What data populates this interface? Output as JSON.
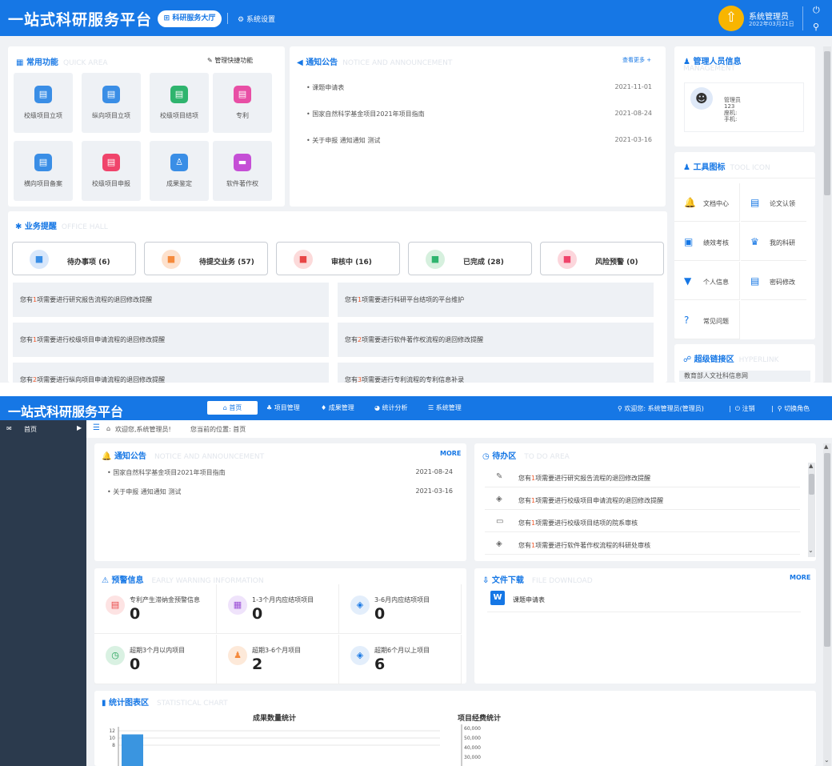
{
  "top": {
    "brand": "一站式科研服务平台",
    "nav_active": "科研服务大厅",
    "nav_settings": "系统设置",
    "user_name": "系统管理员",
    "user_date": "2022年03月21日",
    "quick": {
      "title": "常用功能",
      "title_en": "QUICK AREA",
      "manage": "管理快捷功能",
      "items": [
        {
          "label": "校级项目立项",
          "color": "#3a8ee6",
          "glyph": "▤"
        },
        {
          "label": "纵向项目立项",
          "color": "#3a8ee6",
          "glyph": "▤"
        },
        {
          "label": "校级项目结项",
          "color": "#2fb46e",
          "glyph": "▤"
        },
        {
          "label": "专利",
          "color": "#e84fa5",
          "glyph": "▤"
        },
        {
          "label": "横向项目备案",
          "color": "#3a8ee6",
          "glyph": "▤"
        },
        {
          "label": "校级项目申报",
          "color": "#f0446b",
          "glyph": "▤"
        },
        {
          "label": "成果鉴定",
          "color": "#3a8ee6",
          "glyph": "♙"
        },
        {
          "label": "软件著作权",
          "color": "#c54fd6",
          "glyph": "▬"
        }
      ]
    },
    "notice": {
      "title": "通知公告",
      "title_en": "NOTICE AND ANNOUNCEMENT",
      "more": "查看更多 +",
      "items": [
        {
          "text": "课题申请表",
          "date": "2021-11-01"
        },
        {
          "text": "国家自然科学基金项目2021年项目指南",
          "date": "2021-08-24"
        },
        {
          "text": "关于申报 通知通知 测试",
          "date": "2021-03-16"
        }
      ]
    },
    "manager": {
      "title": "管理人员信息",
      "title_en": "MANAGEMENT",
      "name": "管理员",
      "id": "123",
      "phone_label": "座机:",
      "mobile_label": "手机:"
    },
    "tools": {
      "title": "工具图标",
      "title_en": "TOOL ICON",
      "items": [
        {
          "label": "文档中心",
          "glyph": "🔔"
        },
        {
          "label": "论文认领",
          "glyph": "▤"
        },
        {
          "label": "绩效考核",
          "glyph": "▣"
        },
        {
          "label": "我的科研",
          "glyph": "♛"
        },
        {
          "label": "个人信息",
          "glyph": "▼"
        },
        {
          "label": "密码修改",
          "glyph": "▤"
        },
        {
          "label": "常见问题",
          "glyph": "?"
        }
      ]
    },
    "hyperlink": {
      "title": "超级链接区",
      "title_en": "HYPERLINK",
      "first": "教育部人文社科信息网"
    },
    "business": {
      "title": "业务提醒",
      "title_en": "OFFICE HALL",
      "buttons": [
        {
          "label": "待办事项 (6)",
          "color": "#d8e7fb",
          "fg": "#3a8ee6"
        },
        {
          "label": "待提交业务 (57)",
          "color": "#fde1cd",
          "fg": "#f58a3c"
        },
        {
          "label": "审核中 (16)",
          "color": "#fcdada",
          "fg": "#e84545"
        },
        {
          "label": "已完成 (28)",
          "color": "#d6f0de",
          "fg": "#2fb46e"
        },
        {
          "label": "风险预警 (0)",
          "color": "#fcd6dc",
          "fg": "#f0446b"
        }
      ],
      "reminders": [
        {
          "pre": "您有",
          "n": "1",
          "post": "项需要进行研究报告流程的退回修改提醒"
        },
        {
          "pre": "您有",
          "n": "1",
          "post": "项需要进行科研平台结项的平台维护"
        },
        {
          "pre": "您有",
          "n": "1",
          "post": "项需要进行校级项目申请流程的退回修改提醒"
        },
        {
          "pre": "您有",
          "n": "2",
          "post": "项需要进行软件著作权流程的退回修改提醒"
        },
        {
          "pre": "您有",
          "n": "2",
          "post": "项需要进行纵向项目申请流程的退回修改提醒"
        },
        {
          "pre": "您有",
          "n": "3",
          "post": "项需要进行专利流程的专利信息补录"
        }
      ]
    }
  },
  "bottom": {
    "brand": "一站式科研服务平台",
    "nav": [
      "首页",
      "项目管理",
      "成果管理",
      "统计分析",
      "系统管理"
    ],
    "welcome": "欢迎您: 系统管理员(管理员)",
    "logout": "注销",
    "switch_role": "切换角色",
    "sidebar_home": "首页",
    "breadcrumb_welcome": "欢迎您,系统管理员!",
    "breadcrumb_loc": "您当前的位置: 首页",
    "notice": {
      "title": "通知公告",
      "title_en": "NOTICE AND ANNOUNCEMENT",
      "more": "MORE",
      "items": [
        {
          "text": "国家自然科学基金项目2021年项目指南",
          "date": "2021-08-24"
        },
        {
          "text": "关于申报 通知通知 测试",
          "date": "2021-03-16"
        }
      ]
    },
    "todo": {
      "title": "待办区",
      "title_en": "TO DO AREA",
      "items": [
        {
          "glyph": "✎",
          "pre": "您有",
          "n": "1",
          "post": "项需要进行研究报告流程的退回修改提醒"
        },
        {
          "glyph": "◈",
          "pre": "您有",
          "n": "1",
          "post": "项需要进行校级项目申请流程的退回修改提醒"
        },
        {
          "glyph": "▭",
          "pre": "您有",
          "n": "1",
          "post": "项需要进行校级项目结项的院系审核"
        },
        {
          "glyph": "◈",
          "pre": "您有",
          "n": "1",
          "post": "项需要进行软件著作权流程的科研处审核"
        }
      ]
    },
    "warning": {
      "title": "预警信息",
      "title_en": "EARLY WARNING INFORMATION",
      "items": [
        {
          "label": "专利产生滞纳金预警信息",
          "value": "0",
          "bg": "#fde3e3",
          "fg": "#e84545",
          "glyph": "▤"
        },
        {
          "label": "1-3个月内应结项项目",
          "value": "0",
          "bg": "#efe3fb",
          "fg": "#9b4fd6",
          "glyph": "▦"
        },
        {
          "label": "3-6月内应结项项目",
          "value": "0",
          "bg": "#e3eefb",
          "fg": "#1677e5",
          "glyph": "◈"
        },
        {
          "label": "超期3个月以内项目",
          "value": "0",
          "bg": "#d9f1e2",
          "fg": "#21a056",
          "glyph": "◷"
        },
        {
          "label": "超期3-6个月项目",
          "value": "2",
          "bg": "#fde9d9",
          "fg": "#f58a3c",
          "glyph": "♟"
        },
        {
          "label": "超期6个月以上项目",
          "value": "6",
          "bg": "#e3eefb",
          "fg": "#1677e5",
          "glyph": "◈"
        }
      ]
    },
    "download": {
      "title": "文件下载",
      "title_en": "FILE DOWNLOAD",
      "more": "MORE",
      "file": "课题申请表"
    },
    "stats": {
      "title": "统计图表区",
      "title_en": "STATISTICAL CHART"
    }
  },
  "chart_data": [
    {
      "type": "bar",
      "title": "成果数量统计",
      "yticks": [
        "12",
        "10",
        "8"
      ],
      "ylim": [
        0,
        12
      ],
      "values": [
        11
      ]
    },
    {
      "type": "bar",
      "title": "项目经费统计",
      "yticks": [
        "60,000",
        "50,000",
        "40,000",
        "30,000"
      ]
    }
  ]
}
